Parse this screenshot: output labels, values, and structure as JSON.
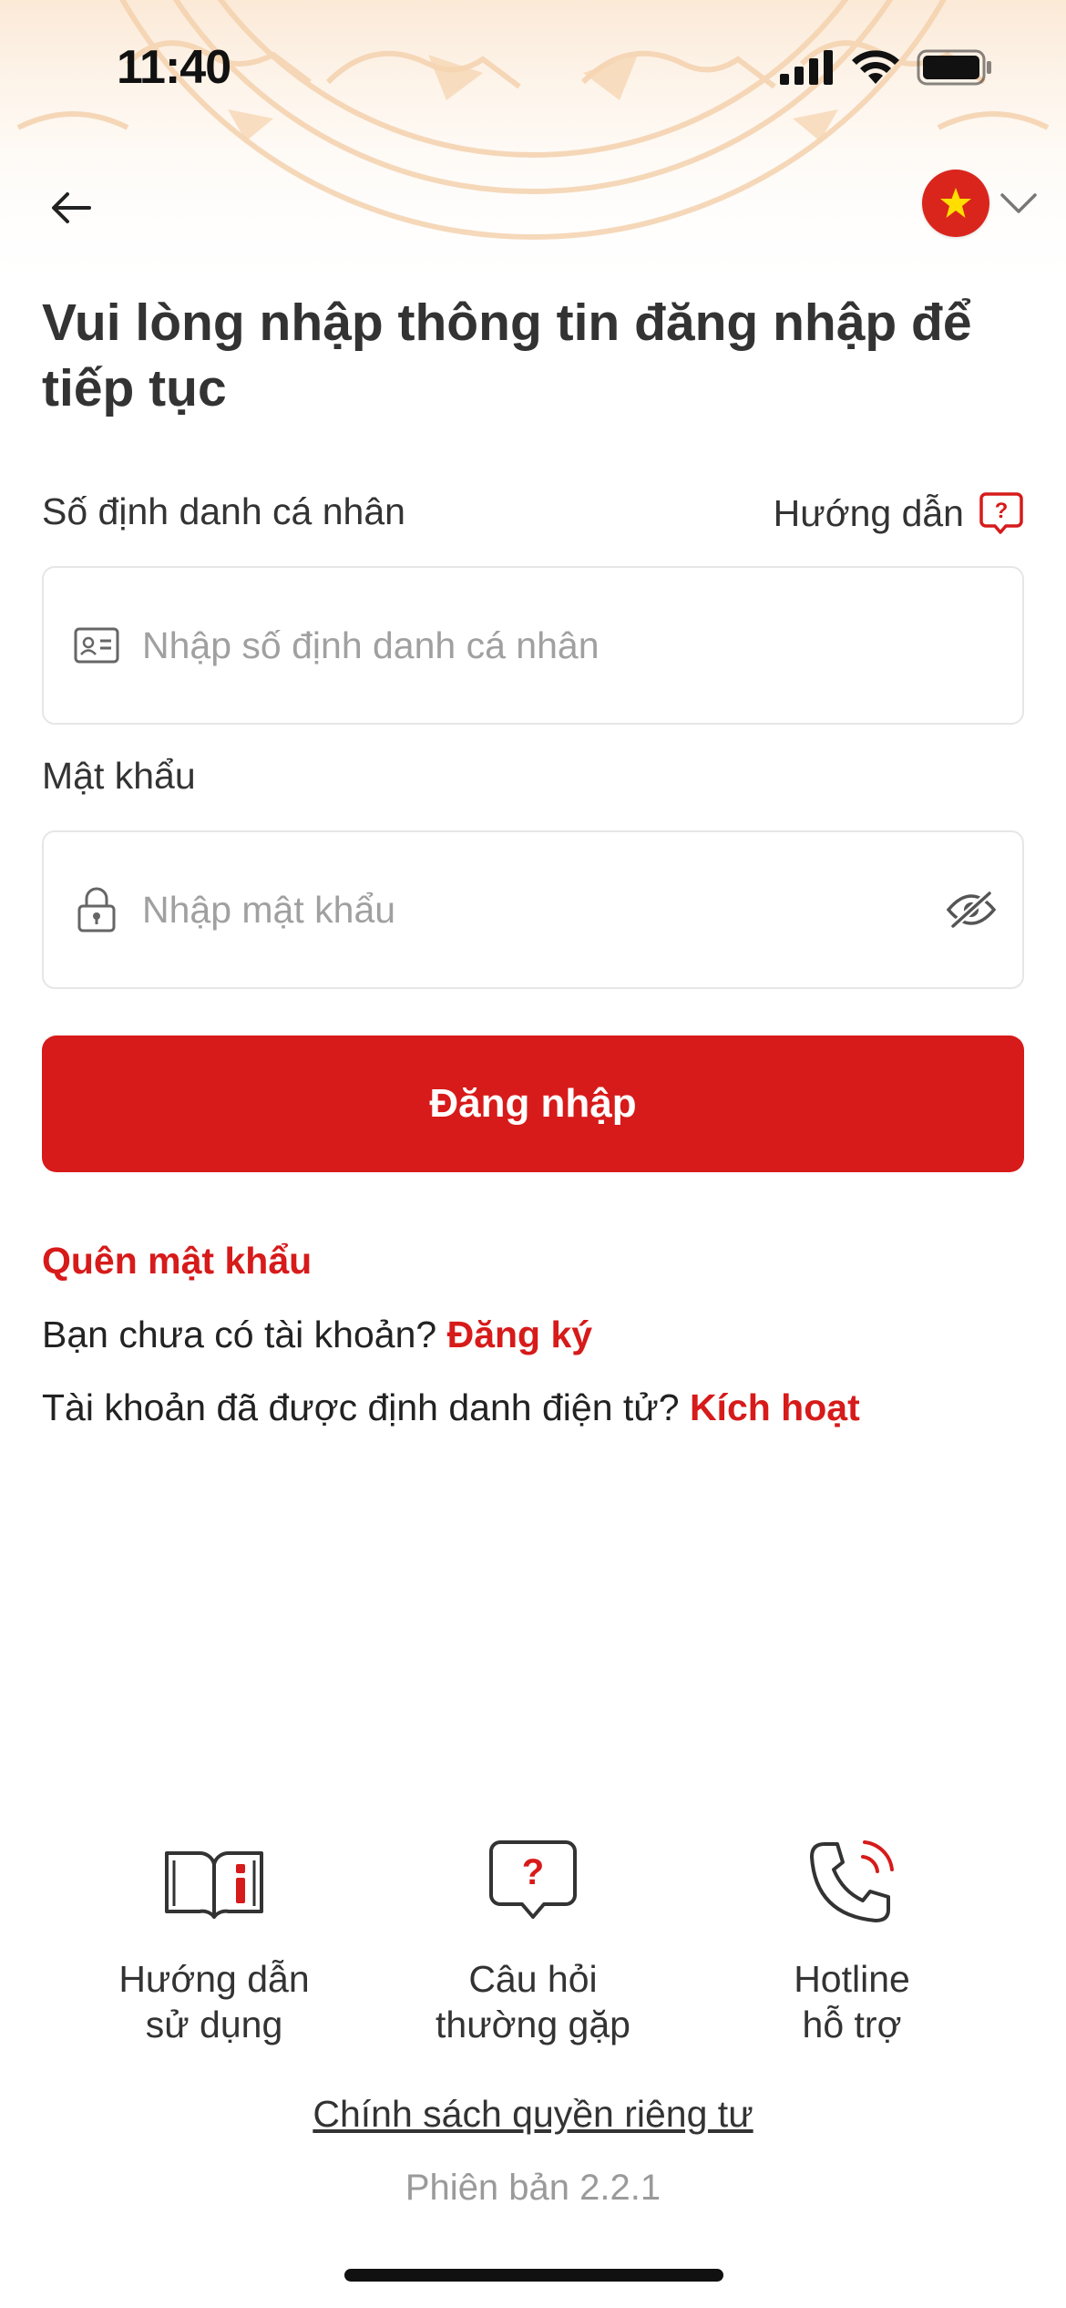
{
  "status_bar": {
    "time": "11:40"
  },
  "header": {
    "flag_icon": "vietnam-flag-icon",
    "language_chevron": "chevron-down-icon"
  },
  "title": "Vui lòng nhập thông tin đăng nhập để tiếp tục",
  "form": {
    "id_label": "Số định danh cá nhân",
    "guide_label": "Hướng dẫn",
    "id_placeholder": "Nhập số định danh cá nhân",
    "password_label": "Mật khẩu",
    "password_placeholder": "Nhập mật khẩu",
    "login_label": "Đăng nhập"
  },
  "links": {
    "forgot_password": "Quên mật khẩu",
    "no_account_text": "Bạn chưa có tài khoản?",
    "register": "Đăng ký",
    "activated_text": "Tài khoản đã được định danh điện tử?",
    "activate": "Kích hoạt"
  },
  "quick_links": [
    {
      "line1": "Hướng dẫn",
      "line2": "sử dụng",
      "icon": "book-info-icon"
    },
    {
      "line1": "Câu hỏi",
      "line2": "thường gặp",
      "icon": "question-bubble-icon"
    },
    {
      "line1": "Hotline",
      "line2": "hỗ trợ",
      "icon": "phone-call-icon"
    }
  ],
  "footer": {
    "privacy": "Chính sách quyền riêng tư",
    "version": "Phiên bản 2.2.1"
  },
  "colors": {
    "primary": "#d71a1a",
    "hero_pattern": "#f6d9b8"
  }
}
